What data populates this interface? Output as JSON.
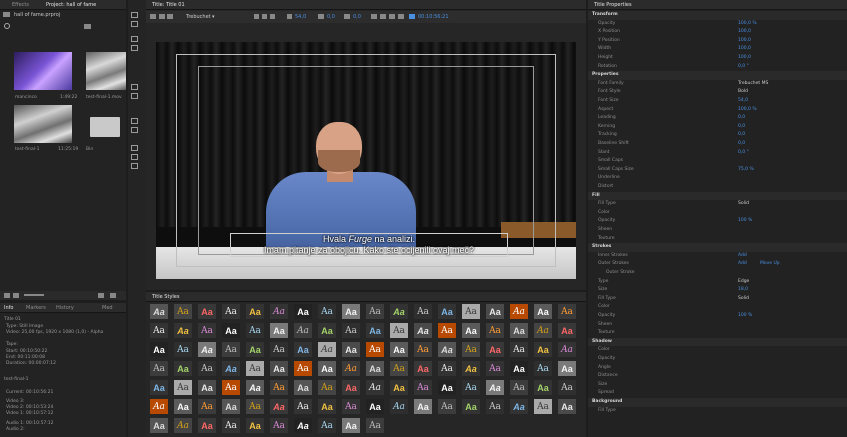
{
  "project_panel": {
    "tabs": [
      "Effects",
      "Project: hall of fame"
    ],
    "project_file": "hall of fame.prproj",
    "items": [
      {
        "name": "mancinco",
        "duration": "1:49:22"
      },
      {
        "name": "test-final-1.mov",
        "duration": ""
      },
      {
        "name": "test-final-1",
        "duration": "11:25:19"
      },
      {
        "name": "Bin",
        "duration": ""
      }
    ]
  },
  "info_panel": {
    "tabs": [
      "Info",
      "Markers",
      "History",
      "Med"
    ],
    "clip_title": "Title 01",
    "type": "Type: Still Image",
    "video": "Video: 25,00 fps, 1920 x 1080 (1,0) - Alpha",
    "tape": "Tape:",
    "start": "Start: 00:10:50:22",
    "end": "End: 00:11:00:08",
    "duration": "Duration: 00:00:07:12",
    "seq_name": "test-final-1",
    "current": "Current: 00:10:56:21",
    "video3": "Video 3:",
    "video2": "Video 2: 00:10:53:24",
    "video1": "Video 1: 00:10:57:12",
    "audio1": "Audio 1: 00:10:57:12",
    "audio2": "Audio 2:"
  },
  "title_panel": {
    "tab": "Title: Title 01",
    "font": "Trebuchet",
    "font_style": "Bold",
    "size": "54,0",
    "kerning": "0,0",
    "leading": "0,0",
    "timecode": "00:10:56:21",
    "caption_line1_pre": "Hvala ",
    "caption_line1_em": "Furge",
    "caption_line1_post": " na analizi.",
    "caption_line2": "Imam pitanje za obojicu. Kako ste ocijenili ovaj meč?"
  },
  "styles_panel": {
    "tab": "Title Styles",
    "sample": "Aa"
  },
  "properties_panel": {
    "tab": "Title Properties",
    "rows": [
      {
        "label": "Transform",
        "value": "",
        "section": true
      },
      {
        "label": "Opacity",
        "value": "100,0 %"
      },
      {
        "label": "X Position",
        "value": "100,0"
      },
      {
        "label": "Y Position",
        "value": "100,0"
      },
      {
        "label": "Width",
        "value": "100,0"
      },
      {
        "label": "Height",
        "value": "100,0"
      },
      {
        "label": "Rotation",
        "value": "0,0 °"
      },
      {
        "label": "Properties",
        "value": "",
        "section": true
      },
      {
        "label": "Font Family",
        "value": "Trebuchet MS",
        "white": true
      },
      {
        "label": "Font Style",
        "value": "Bold",
        "white": true
      },
      {
        "label": "Font Size",
        "value": "54,0"
      },
      {
        "label": "Aspect",
        "value": "100,0 %"
      },
      {
        "label": "Leading",
        "value": "0,0"
      },
      {
        "label": "Kerning",
        "value": "0,0"
      },
      {
        "label": "Tracking",
        "value": "0,0"
      },
      {
        "label": "Baseline Shift",
        "value": "0,0"
      },
      {
        "label": "Slant",
        "value": "0,0 °"
      },
      {
        "label": "Small Caps",
        "value": ""
      },
      {
        "label": "Small Caps Size",
        "value": "75,0 %"
      },
      {
        "label": "Underline",
        "value": ""
      },
      {
        "label": "Distort",
        "value": ""
      },
      {
        "label": "Fill",
        "value": "",
        "section": true
      },
      {
        "label": "Fill Type",
        "value": "Solid",
        "white": true
      },
      {
        "label": "Color",
        "value": ""
      },
      {
        "label": "Opacity",
        "value": "100 %"
      },
      {
        "label": "Sheen",
        "value": ""
      },
      {
        "label": "Texture",
        "value": ""
      },
      {
        "label": "Strokes",
        "value": "",
        "section": true
      },
      {
        "label": "Inner Strokes",
        "value": "Add"
      },
      {
        "label": "Outer Strokes",
        "value": "Add"
      },
      {
        "label": "Outer Stroke",
        "value": "",
        "sub": true
      },
      {
        "label": "Type",
        "value": "Edge",
        "white": true
      },
      {
        "label": "Size",
        "value": "18,0"
      },
      {
        "label": "Fill Type",
        "value": "Solid",
        "white": true
      },
      {
        "label": "Color",
        "value": ""
      },
      {
        "label": "Opacity",
        "value": "100 %"
      },
      {
        "label": "Sheen",
        "value": ""
      },
      {
        "label": "Texture",
        "value": ""
      },
      {
        "label": "Shadow",
        "value": "",
        "section": true
      },
      {
        "label": "Color",
        "value": ""
      },
      {
        "label": "Opacity",
        "value": ""
      },
      {
        "label": "Angle",
        "value": ""
      },
      {
        "label": "Distance",
        "value": ""
      },
      {
        "label": "Size",
        "value": ""
      },
      {
        "label": "Spread",
        "value": ""
      },
      {
        "label": "Background",
        "value": "",
        "section": true
      },
      {
        "label": "Fill Type",
        "value": ""
      }
    ],
    "move_up": "Move Up"
  },
  "colors": {
    "accent": "#4a90e2",
    "panel_bg": "#232323",
    "app_bg": "#1d1d1d"
  }
}
